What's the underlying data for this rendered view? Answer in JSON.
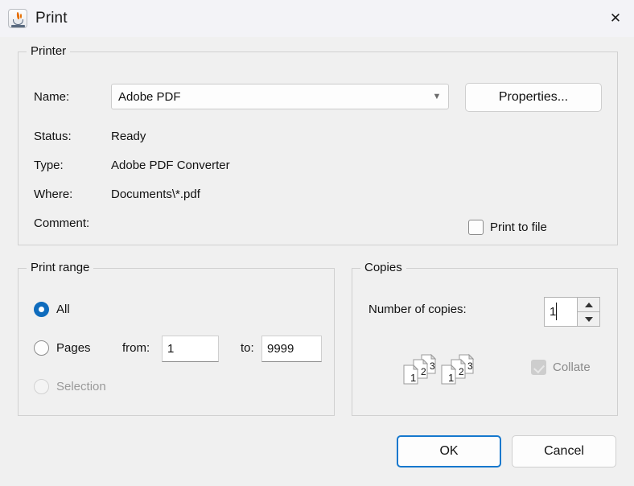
{
  "window": {
    "title": "Print",
    "app_icon": "java-coffee-cup-icon",
    "close_icon": "close-icon"
  },
  "printer": {
    "group_title": "Printer",
    "name_label": "Name:",
    "name_value": "Adobe PDF",
    "dropdown_icon": "chevron-down-icon",
    "properties_button": "Properties...",
    "status_label": "Status:",
    "status_value": "Ready",
    "type_label": "Type:",
    "type_value": "Adobe PDF Converter",
    "where_label": "Where:",
    "where_value": "Documents\\*.pdf",
    "comment_label": "Comment:",
    "comment_value": "",
    "print_to_file_label": "Print to file",
    "print_to_file_checked": false
  },
  "print_range": {
    "group_title": "Print range",
    "all_label": "All",
    "all_selected": true,
    "pages_label": "Pages",
    "pages_selected": false,
    "from_label": "from:",
    "from_value": "1",
    "to_label": "to:",
    "to_value": "9999",
    "selection_label": "Selection",
    "selection_enabled": false
  },
  "copies": {
    "group_title": "Copies",
    "number_label": "Number of copies:",
    "number_value": "1",
    "spin_up_icon": "triangle-up-icon",
    "spin_down_icon": "triangle-down-icon",
    "collate_label": "Collate",
    "collate_checked": true,
    "collate_enabled": false,
    "collate_art_page_numbers": [
      "1",
      "2",
      "3"
    ]
  },
  "footer": {
    "ok_label": "OK",
    "cancel_label": "Cancel"
  },
  "colors": {
    "accent": "#0f6cbd",
    "focus_border": "#1578cd",
    "dialog_bg": "#f0f0f0",
    "titlebar_bg": "#f3f3f7",
    "java_orange": "#e76f00"
  }
}
